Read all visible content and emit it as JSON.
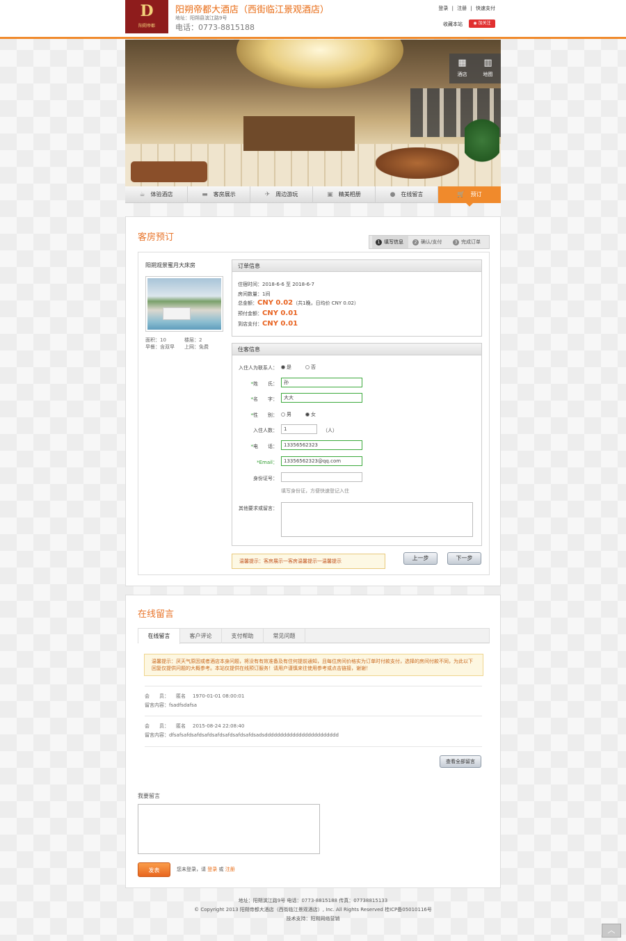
{
  "header": {
    "logo_letter": "D",
    "logo_sub": "阳朔帝都",
    "title": "阳朔帝都大酒店（西街临江景观酒店）",
    "address": "地址：阳朔县滨江路9号",
    "phone": "电话：0773-8815188",
    "links": [
      "登录",
      "注册",
      "快速支付"
    ],
    "link_sep": "|",
    "favorite": "收藏本站",
    "weibo": "加关注"
  },
  "banner": {
    "buttons": [
      {
        "label": "酒店",
        "icon": "hotel-icon"
      },
      {
        "label": "地图",
        "icon": "map-icon"
      }
    ]
  },
  "nav": {
    "items": [
      {
        "label": "体验酒店",
        "icon": "cup-icon"
      },
      {
        "label": "客房展示",
        "icon": "bed-icon"
      },
      {
        "label": "周边游玩",
        "icon": "plane-icon"
      },
      {
        "label": "精美相册",
        "icon": "photo-icon"
      },
      {
        "label": "在线留言",
        "icon": "chat-icon"
      },
      {
        "label": "预订",
        "icon": "cart-icon"
      }
    ],
    "active_index": 5
  },
  "booking": {
    "title": "客房预订",
    "steps": [
      {
        "num": "1",
        "label": "填写信息"
      },
      {
        "num": "2",
        "label": "确认/支付"
      },
      {
        "num": "3",
        "label": "完成订单"
      }
    ],
    "room": {
      "name": "阳朔观景蜜月大床房",
      "area": "面积：10",
      "floor": "楼层：2",
      "breakfast": "早餐：含双早",
      "internet": "上网：免费"
    },
    "order": {
      "heading": "订单信息",
      "stay": "住宿时间：2018-6-6 至 2018-6-7",
      "rooms": "房间数量：1间",
      "total_label": "总金额：",
      "total_value": "CNY 0.02",
      "total_note": "（共1晚，日均价 CNY 0.02）",
      "prepay_label": "预付金额：",
      "prepay_value": "CNY 0.01",
      "hotel_pay_label": "到店支付：",
      "hotel_pay_value": "CNY 0.01"
    },
    "guest": {
      "heading": "住客信息",
      "is_contact_label": "入住人为联系人：",
      "yes": "是",
      "no": "否",
      "surname_label": "姓　　氏：",
      "surname_value": "孙",
      "name_label": "名　　字：",
      "name_value": "大大",
      "gender_label": "性　　别：",
      "male": "男",
      "female": "女",
      "count_label": "入住人数：",
      "count_value": "1",
      "count_unit": "（人）",
      "phone_label": "电　　话：",
      "phone_value": "13356562323",
      "email_label": "Email：",
      "email_value": "13356562323@qq.com",
      "id_label": "身份证号：",
      "id_value": "",
      "id_hint": "填写身份证，方便快速登记入住",
      "remark_label": "其他要求或留言："
    },
    "tip": "温馨提示：客房展示一客房温馨提示一温馨提示",
    "prev": "上一步",
    "next": "下一步"
  },
  "messages": {
    "title": "在线留言",
    "tabs": [
      "在线留言",
      "客户评论",
      "支付帮助",
      "常见问题"
    ],
    "notice": "温馨提示：厌天气原因或者酒店本身问题，将没有有效准备及有住何提前通知，且每位房间价格实为订单时付款支付，选择的房间付款不同，为此以下回复仅提供问题的大概参考。本站仅提供在线预订服务！请用户谨慎来往使用参考或点击链接，谢谢！",
    "list": [
      {
        "user_label": "会　　员：",
        "user": "匿名",
        "time": "1970-01-01 08:00:01",
        "content_label": "留言内容：",
        "content": "fsadfsdafsa"
      },
      {
        "user_label": "会　　员：",
        "user": "匿名",
        "time": "2015-08-24 22:08:40",
        "content_label": "留言内容：",
        "content": "dfsafsafdsafdsafdsafdsafdsafdsafdsadsdddddddddddddddddddddddd"
      }
    ],
    "view_all": "查看全部留言",
    "write_label": "我要留言",
    "submit": "发表",
    "login_hint_prefix": "您未登录，请",
    "login_link": "登录",
    "login_or": "或",
    "register_link": "注册"
  },
  "footer": {
    "line1": "地址：阳朔滨江路9号 电话：0773-8815188 传真：07738815133",
    "line2": "© Copyright 2013 阳朔帝都大酒店（西街临江景观酒店）, Inc. All Rights Reserved 桂ICP备05010116号",
    "line3": "技术支持：阳朔网络营销"
  },
  "colors": {
    "accent": "#f08a2c",
    "price": "#e8621f",
    "valid": "#3aa83a"
  }
}
